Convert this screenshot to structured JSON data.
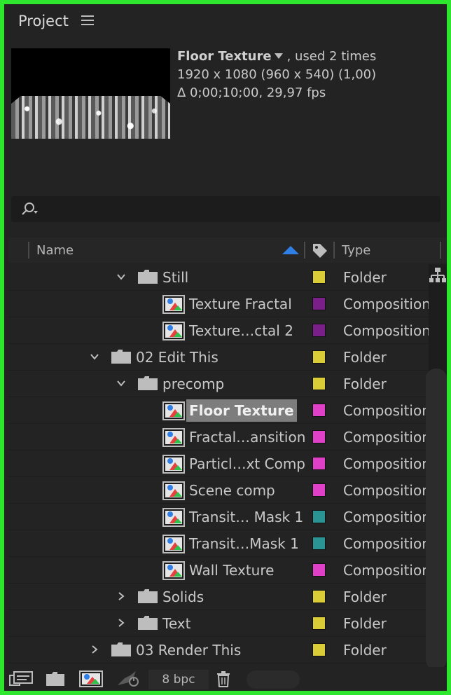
{
  "panel": {
    "title": "Project"
  },
  "preview": {
    "name": "Floor Texture",
    "used": ", used 2 times",
    "resolution": "1920 x 1080  (960 x 540) (1,00)",
    "duration": "Δ 0;00;10;00, 29,97 fps"
  },
  "search": {
    "placeholder": ""
  },
  "columns": {
    "name": "Name",
    "type": "Type"
  },
  "colors": {
    "yellow": "#d9cc36",
    "purple": "#7a1f8a",
    "pink": "#e040c8",
    "teal": "#2a9393",
    "accent_blue": "#2f7fe6",
    "border_green": "#2ee62e"
  },
  "rows": [
    {
      "name": "Still",
      "type": "Folder",
      "kind": "folder",
      "depth": 2,
      "twisty": "open",
      "color": "yellow"
    },
    {
      "name": "Texture Fractal",
      "type": "Composition",
      "kind": "comp",
      "depth": 3,
      "twisty": "none",
      "color": "purple"
    },
    {
      "name": "Texture…ctal 2",
      "type": "Composition",
      "kind": "comp",
      "depth": 3,
      "twisty": "none",
      "color": "purple"
    },
    {
      "name": "02 Edit This",
      "type": "Folder",
      "kind": "folder",
      "depth": 1,
      "twisty": "open",
      "color": "yellow"
    },
    {
      "name": "precomp",
      "type": "Folder",
      "kind": "folder",
      "depth": 2,
      "twisty": "open",
      "color": "yellow"
    },
    {
      "name": "Floor Texture",
      "type": "Composition",
      "kind": "comp",
      "depth": 3,
      "twisty": "none",
      "color": "pink",
      "selected": true
    },
    {
      "name": "Fractal…ansition",
      "type": "Composition",
      "kind": "comp",
      "depth": 3,
      "twisty": "none",
      "color": "pink"
    },
    {
      "name": "Particl…xt Comp",
      "type": "Composition",
      "kind": "comp",
      "depth": 3,
      "twisty": "none",
      "color": "pink"
    },
    {
      "name": "Scene comp",
      "type": "Composition",
      "kind": "comp",
      "depth": 3,
      "twisty": "none",
      "color": "pink"
    },
    {
      "name": "Transit… Mask 1",
      "type": "Composition",
      "kind": "comp",
      "depth": 3,
      "twisty": "none",
      "color": "teal"
    },
    {
      "name": "Transit…Mask 1",
      "type": "Composition",
      "kind": "comp",
      "depth": 3,
      "twisty": "none",
      "color": "teal"
    },
    {
      "name": "Wall Texture",
      "type": "Composition",
      "kind": "comp",
      "depth": 3,
      "twisty": "none",
      "color": "pink"
    },
    {
      "name": "Solids",
      "type": "Folder",
      "kind": "folder",
      "depth": 2,
      "twisty": "closed",
      "color": "yellow"
    },
    {
      "name": "Text",
      "type": "Folder",
      "kind": "folder",
      "depth": 2,
      "twisty": "closed",
      "color": "yellow"
    },
    {
      "name": "03 Render This",
      "type": "Folder",
      "kind": "folder",
      "depth": 1,
      "twisty": "closed",
      "color": "yellow"
    }
  ],
  "footer": {
    "bpc": "8 bpc"
  }
}
